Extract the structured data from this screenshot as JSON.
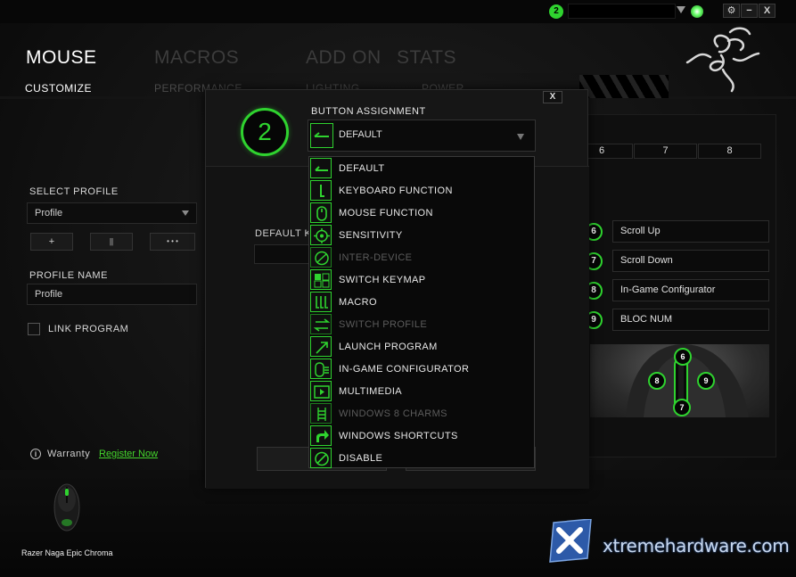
{
  "topbar": {
    "notification_count": "2",
    "window_buttons": [
      "⚙",
      "−",
      "X"
    ]
  },
  "nav": {
    "main": [
      "MOUSE",
      "MACROS",
      "ADD ON",
      "STATS"
    ],
    "sub": [
      "CUSTOMIZE",
      "PERFORMANCE",
      "LIGHTING",
      "POWER"
    ]
  },
  "left": {
    "select_profile_label": "SELECT PROFILE",
    "profile_value": "Profile",
    "add_button": "+",
    "delete_button": "▮",
    "more_button": "• • •",
    "profile_name_label": "PROFILE NAME",
    "profile_name_value": "Profile",
    "link_program_label": "LINK PROGRAM",
    "warranty_label": "Warranty",
    "register_link": "Register Now"
  },
  "right": {
    "tabs": [
      "6",
      "7",
      "8"
    ],
    "mappings": [
      {
        "num": "6",
        "label": "Scroll Up"
      },
      {
        "num": "7",
        "label": "Scroll Down"
      },
      {
        "num": "8",
        "label": "In-Game Configurator"
      },
      {
        "num": "9",
        "label": "BLOC NUM"
      }
    ],
    "side_buttons": [
      "6",
      "8",
      "9",
      "7"
    ]
  },
  "modal": {
    "close": "X",
    "button_number": "2",
    "title": "BUTTON ASSIGNMENT",
    "selected": "DEFAULT",
    "default_key_label": "DEFAULT K"
  },
  "dropdown": {
    "items": [
      {
        "label": "DEFAULT",
        "icon": "default-icon",
        "enabled": true
      },
      {
        "label": "KEYBOARD FUNCTION",
        "icon": "keyboard-icon",
        "enabled": true
      },
      {
        "label": "MOUSE FUNCTION",
        "icon": "mouse-icon",
        "enabled": true
      },
      {
        "label": "SENSITIVITY",
        "icon": "crosshair-icon",
        "enabled": true
      },
      {
        "label": "INTER-DEVICE",
        "icon": "link-icon",
        "enabled": false
      },
      {
        "label": "SWITCH KEYMAP",
        "icon": "keymap-icon",
        "enabled": true
      },
      {
        "label": "MACRO",
        "icon": "macro-icon",
        "enabled": true
      },
      {
        "label": "SWITCH PROFILE",
        "icon": "swap-icon",
        "enabled": false
      },
      {
        "label": "LAUNCH PROGRAM",
        "icon": "launch-icon",
        "enabled": true
      },
      {
        "label": "IN-GAME CONFIGURATOR",
        "icon": "configurator-icon",
        "enabled": true
      },
      {
        "label": "MULTIMEDIA",
        "icon": "play-icon",
        "enabled": true
      },
      {
        "label": "WINDOWS 8 CHARMS",
        "icon": "charms-icon",
        "enabled": false
      },
      {
        "label": "WINDOWS SHORTCUTS",
        "icon": "shortcut-icon",
        "enabled": true
      },
      {
        "label": "DISABLE",
        "icon": "disable-icon",
        "enabled": true
      }
    ]
  },
  "footer": {
    "device_name": "Razer Naga Epic Chroma",
    "watermark": "xtremehardware.com"
  },
  "colors": {
    "accent": "#2fd32f",
    "background": "#0b0b0b"
  }
}
